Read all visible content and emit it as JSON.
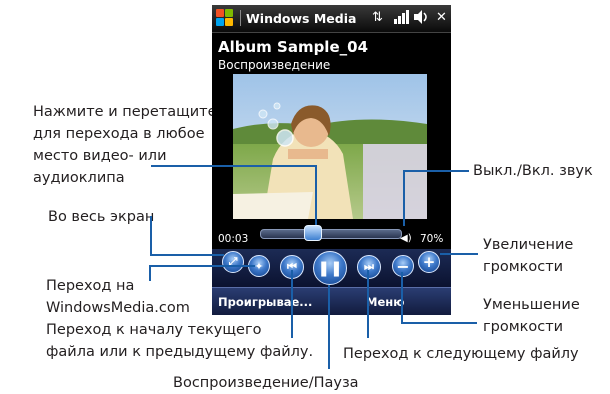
{
  "phone": {
    "app_title": "Windows Media",
    "clip_title": "Album Sample_04",
    "status": "Воспроизведение",
    "time_current": "00:03",
    "volume_pct": "70%",
    "softkey_left": "Проигрывае...",
    "softkey_right": "Меню"
  },
  "callouts": {
    "seek_hint": "Нажмите и перетащите\nдля перехода в любое\nместо видео- или\nаудиоклипа",
    "fullscreen": "Во весь экран",
    "website": "Переход на\nWindowsMedia.com",
    "previous": "Переход к началу текущего\nфайла или к предыдущему файлу.",
    "play_pause": "Воспроизведение/Пауза",
    "mute": "Выкл./Вкл. звук",
    "volume_up": "Увеличение\nгромкости",
    "volume_down": "Уменьшение\nгромкости",
    "next": "Переход к следующему файлу"
  },
  "colors": {
    "callout_line": "#1a5fa8",
    "control_blue": "#3d78c9"
  }
}
